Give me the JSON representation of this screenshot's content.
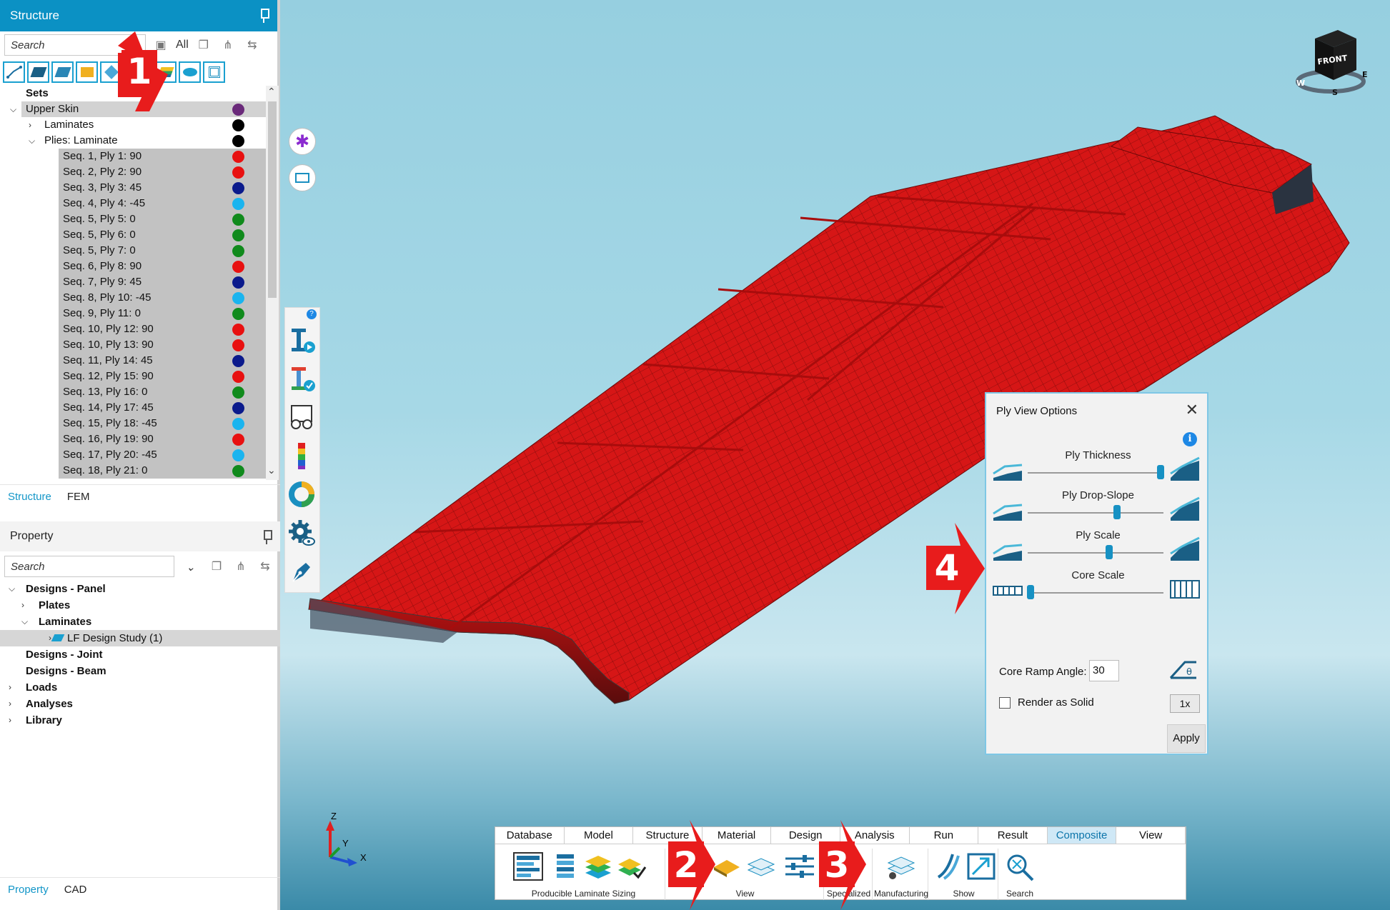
{
  "structure_panel": {
    "title": "Structure",
    "search_placeholder": "Search",
    "all_label": "All",
    "tree": [
      {
        "label": "Sets",
        "level": 0,
        "bold": true,
        "expander": "none"
      },
      {
        "label": "Upper Skin",
        "level": 0,
        "expander": "open",
        "color": "#6a2a7a",
        "style": "sel"
      },
      {
        "label": "Laminates",
        "level": 1,
        "expander": "closed",
        "color": "#000000"
      },
      {
        "label": "Plies: Laminate",
        "level": 1,
        "expander": "open",
        "color": "#000000"
      },
      {
        "label": "Seq. 1, Ply 1: 90",
        "level": 2,
        "color": "#e81010",
        "style": "hl"
      },
      {
        "label": "Seq. 2, Ply 2: 90",
        "level": 2,
        "color": "#e81010",
        "style": "hl"
      },
      {
        "label": "Seq. 3, Ply 3: 45",
        "level": 2,
        "color": "#0b1a8c",
        "style": "hl"
      },
      {
        "label": "Seq. 4, Ply 4: -45",
        "level": 2,
        "color": "#1ab4ef",
        "style": "hl"
      },
      {
        "label": "Seq. 5, Ply 5: 0",
        "level": 2,
        "color": "#108a1c",
        "style": "hl"
      },
      {
        "label": "Seq. 5, Ply 6: 0",
        "level": 2,
        "color": "#108a1c",
        "style": "hl"
      },
      {
        "label": "Seq. 5, Ply 7: 0",
        "level": 2,
        "color": "#108a1c",
        "style": "hl"
      },
      {
        "label": "Seq. 6, Ply 8: 90",
        "level": 2,
        "color": "#e81010",
        "style": "hl"
      },
      {
        "label": "Seq. 7, Ply 9: 45",
        "level": 2,
        "color": "#0b1a8c",
        "style": "hl"
      },
      {
        "label": "Seq. 8, Ply 10: -45",
        "level": 2,
        "color": "#1ab4ef",
        "style": "hl"
      },
      {
        "label": "Seq. 9, Ply 11: 0",
        "level": 2,
        "color": "#108a1c",
        "style": "hl"
      },
      {
        "label": "Seq. 10, Ply 12: 90",
        "level": 2,
        "color": "#e81010",
        "style": "hl"
      },
      {
        "label": "Seq. 10, Ply 13: 90",
        "level": 2,
        "color": "#e81010",
        "style": "hl"
      },
      {
        "label": "Seq. 11, Ply 14: 45",
        "level": 2,
        "color": "#0b1a8c",
        "style": "hl"
      },
      {
        "label": "Seq. 12, Ply 15: 90",
        "level": 2,
        "color": "#e81010",
        "style": "hl"
      },
      {
        "label": "Seq. 13, Ply 16: 0",
        "level": 2,
        "color": "#108a1c",
        "style": "hl"
      },
      {
        "label": "Seq. 14, Ply 17: 45",
        "level": 2,
        "color": "#0b1a8c",
        "style": "hl"
      },
      {
        "label": "Seq. 15, Ply 18: -45",
        "level": 2,
        "color": "#1ab4ef",
        "style": "hl"
      },
      {
        "label": "Seq. 16, Ply 19: 90",
        "level": 2,
        "color": "#e81010",
        "style": "hl"
      },
      {
        "label": "Seq. 17, Ply 20: -45",
        "level": 2,
        "color": "#1ab4ef",
        "style": "hl"
      },
      {
        "label": "Seq. 18, Ply 21: 0",
        "level": 2,
        "color": "#108a1c",
        "style": "hl"
      }
    ],
    "tabs": [
      "Structure",
      "FEM"
    ],
    "active_tab": "Structure"
  },
  "property_panel": {
    "title": "Property",
    "search_placeholder": "Search",
    "tree": [
      {
        "label": "Designs - Panel",
        "level": 0,
        "expander": "open"
      },
      {
        "label": "Plates",
        "level": 1,
        "expander": "closed"
      },
      {
        "label": "Laminates",
        "level": 1,
        "expander": "open"
      },
      {
        "label": "LF Design Study (1)",
        "level": 2,
        "expander": "closed",
        "icon": true,
        "style": "sel"
      },
      {
        "label": "Designs - Joint",
        "level": 0,
        "expander": "none"
      },
      {
        "label": "Designs - Beam",
        "level": 0,
        "expander": "none"
      },
      {
        "label": "Loads",
        "level": 0,
        "expander": "closed"
      },
      {
        "label": "Analyses",
        "level": 0,
        "expander": "closed"
      },
      {
        "label": "Library",
        "level": 0,
        "expander": "closed"
      }
    ],
    "tabs": [
      "Property",
      "CAD"
    ],
    "active_tab": "Property"
  },
  "view_cube": {
    "face_label": "FRONT",
    "compass": [
      "W",
      "S",
      "E"
    ]
  },
  "axis_triad": {
    "z": "Z",
    "y": "Y",
    "x": "X"
  },
  "ply_view_options": {
    "title": "Ply View Options",
    "sliders": [
      {
        "label": "Ply Thickness",
        "value": 0.98
      },
      {
        "label": "Ply Drop-Slope",
        "value": 0.66
      },
      {
        "label": "Ply Scale",
        "value": 0.6
      },
      {
        "label": "Core Scale",
        "value": 0.02
      }
    ],
    "core_ramp_angle_label": "Core Ramp Angle:",
    "core_ramp_angle_value": "30",
    "render_as_solid_label": "Render as Solid",
    "render_as_solid_checked": false,
    "scale_button_label": "1x",
    "apply_label": "Apply"
  },
  "ribbon": {
    "tabs": [
      "Database",
      "Model",
      "Structure",
      "Material",
      "Design",
      "Analysis",
      "Run",
      "Result",
      "Composite",
      "View"
    ],
    "active_tab": "Composite",
    "groups": [
      "Producible Laminate Sizing",
      "View",
      "Specialized",
      "Manufacturing",
      "Show",
      "Search"
    ]
  },
  "callouts": [
    "1",
    "2",
    "3",
    "4"
  ],
  "colors": {
    "accent": "#0b91c4",
    "wing": "#d81818",
    "callout": "#e81c1c"
  }
}
